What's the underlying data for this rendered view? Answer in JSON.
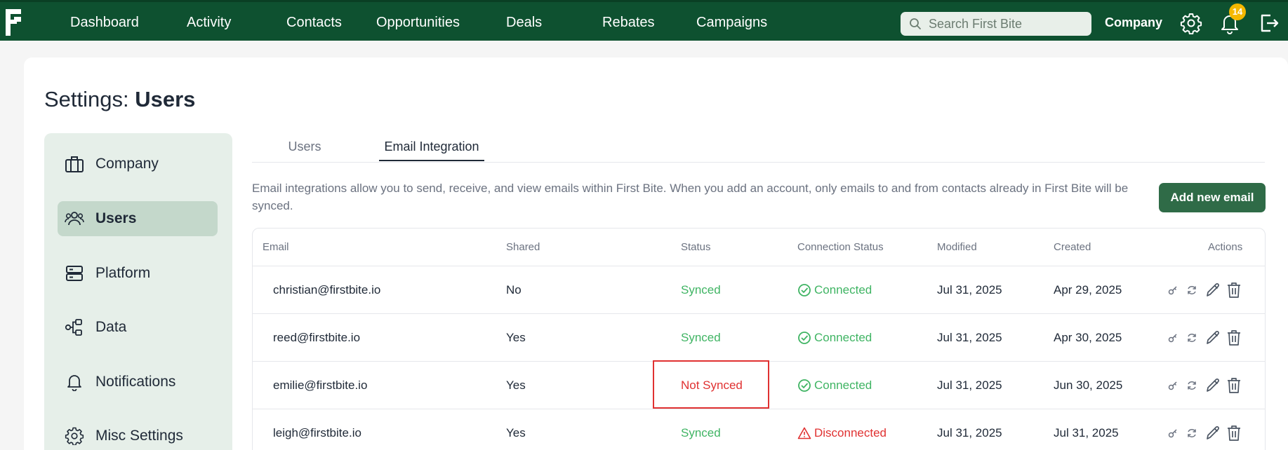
{
  "nav": {
    "items": [
      "Dashboard",
      "Activity",
      "Contacts",
      "Opportunities",
      "Deals",
      "Rebates",
      "Campaigns"
    ],
    "search_placeholder": "Search First Bite",
    "company_label": "Company",
    "notification_count": "14"
  },
  "page": {
    "title_prefix": "Settings:",
    "title_bold": "Users"
  },
  "sidebar": {
    "items": [
      {
        "label": "Company",
        "icon": "briefcase-icon"
      },
      {
        "label": "Users",
        "icon": "users-icon",
        "active": true
      },
      {
        "label": "Platform",
        "icon": "server-icon"
      },
      {
        "label": "Data",
        "icon": "data-flow-icon"
      },
      {
        "label": "Notifications",
        "icon": "bell-icon"
      },
      {
        "label": "Misc Settings",
        "icon": "gear-icon"
      }
    ]
  },
  "tabs": [
    "Users",
    "Email Integration"
  ],
  "description": "Email integrations allow you to send, receive, and view emails within First Bite. When you add an account, only emails to and from contacts already in First Bite will be synced.",
  "add_button": "Add new email",
  "table": {
    "headers": [
      "Email",
      "Shared",
      "Status",
      "Connection Status",
      "Modified",
      "Created",
      "Actions"
    ],
    "rows": [
      {
        "email": "christian@firstbite.io",
        "shared": "No",
        "status": "Synced",
        "connection": "Connected",
        "modified": "Jul 31, 2025",
        "created": "Apr 29, 2025"
      },
      {
        "email": "reed@firstbite.io",
        "shared": "Yes",
        "status": "Synced",
        "connection": "Connected",
        "modified": "Jul 31, 2025",
        "created": "Apr 30, 2025"
      },
      {
        "email": "emilie@firstbite.io",
        "shared": "Yes",
        "status": "Not Synced",
        "connection": "Connected",
        "modified": "Jul 31, 2025",
        "created": "Jun 30, 2025"
      },
      {
        "email": "leigh@firstbite.io",
        "shared": "Yes",
        "status": "Synced",
        "connection": "Disconnected",
        "modified": "Jul 31, 2025",
        "created": "Jul 31, 2025"
      }
    ]
  },
  "colors": {
    "navbar": "#0e5130",
    "accent_button": "#2f6b47",
    "synced": "#3fb463",
    "error": "#e03131",
    "badge": "#f5b800"
  }
}
